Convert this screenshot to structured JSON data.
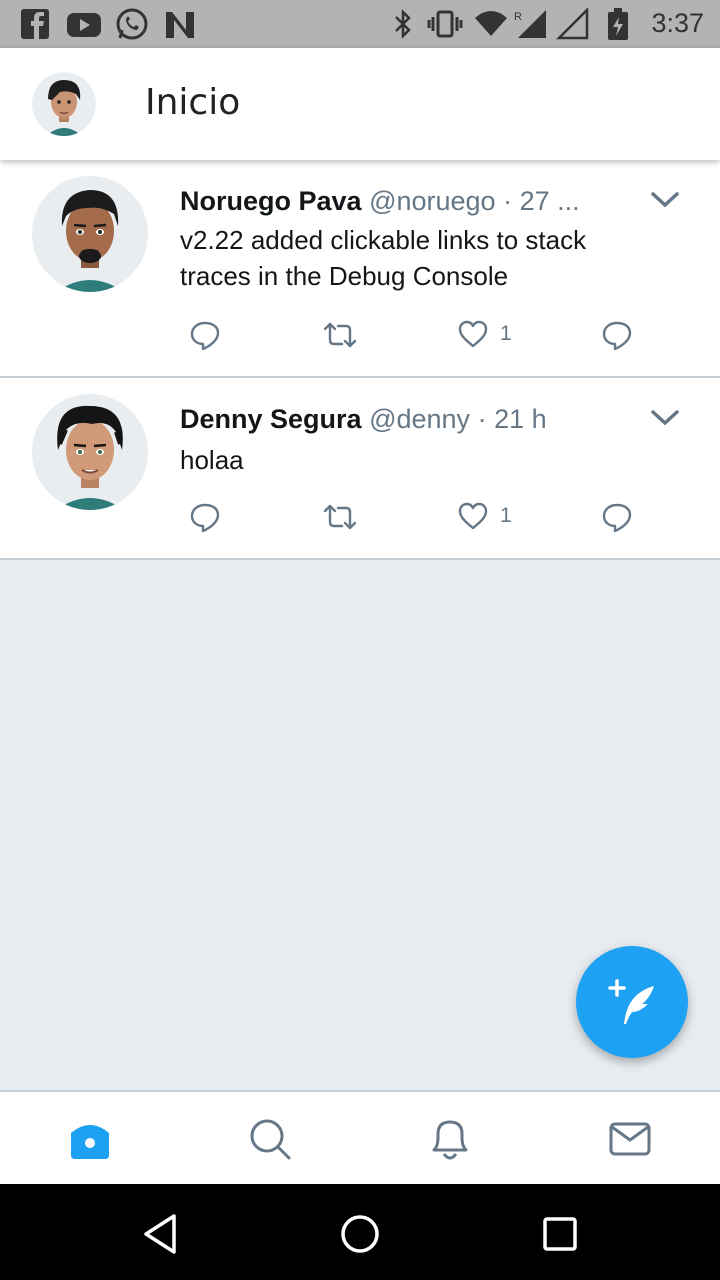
{
  "status_bar": {
    "time": "3:37",
    "left_icons": [
      "facebook-icon",
      "youtube-icon",
      "whatsapp-icon",
      "n-app-icon"
    ],
    "right_icons": [
      "bluetooth-icon",
      "vibrate-icon",
      "wifi-icon",
      "signal-roaming-icon",
      "signal-icon",
      "battery-charging-icon"
    ]
  },
  "header": {
    "title": "Inicio"
  },
  "tweets": [
    {
      "name": "Noruego Pava",
      "handle": "@noruego",
      "dot": "·",
      "time": "27 ...",
      "text": "v2.22 added clickable links to stack traces in the Debug Console",
      "likes": "1"
    },
    {
      "name": "Denny Segura",
      "handle": "@denny",
      "dot": "·",
      "time": "21 h",
      "text": "holaa",
      "likes": "1"
    }
  ],
  "colors": {
    "accent": "#1da1f2",
    "secondary_text": "#657786",
    "background": "#e6ecf0"
  },
  "bottom_nav": [
    "home-icon",
    "search-icon",
    "notifications-icon",
    "messages-icon"
  ],
  "system_nav": [
    "back-icon",
    "home-circle-icon",
    "recents-icon"
  ]
}
